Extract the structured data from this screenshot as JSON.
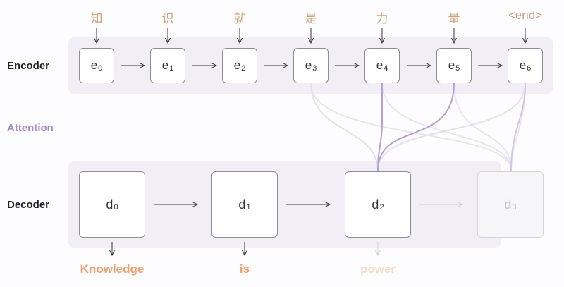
{
  "labels": {
    "encoder": "Encoder",
    "attention": "Attention",
    "decoder": "Decoder"
  },
  "input_tokens": [
    "知",
    "识",
    "就",
    "是",
    "力",
    "量",
    "<end>"
  ],
  "encoder_states": [
    {
      "base": "e",
      "sub": "0"
    },
    {
      "base": "e",
      "sub": "1"
    },
    {
      "base": "e",
      "sub": "2"
    },
    {
      "base": "e",
      "sub": "3"
    },
    {
      "base": "e",
      "sub": "4"
    },
    {
      "base": "e",
      "sub": "5"
    },
    {
      "base": "e",
      "sub": "6"
    }
  ],
  "decoder_states": [
    {
      "base": "d",
      "sub": "0"
    },
    {
      "base": "d",
      "sub": "1"
    },
    {
      "base": "d",
      "sub": "2"
    },
    {
      "base": "d",
      "sub": "3"
    }
  ],
  "output_words": [
    "Knowledge",
    "is",
    "power"
  ],
  "colors": {
    "token": "#c9a27a",
    "output": "#f0a06c",
    "attention": "#a48ac4",
    "panel": "#f1eff5"
  }
}
